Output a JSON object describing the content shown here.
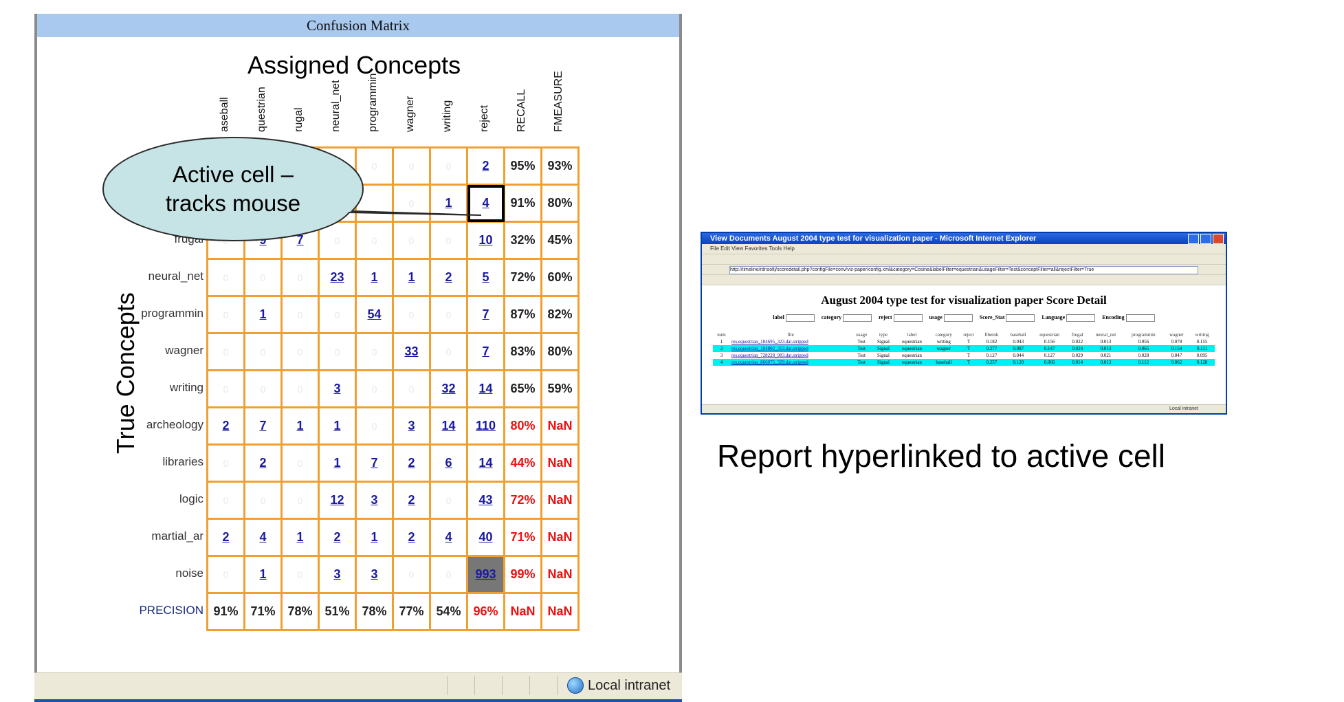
{
  "window": {
    "title": "Confusion Matrix",
    "status_text": "Local intranet"
  },
  "matrix": {
    "heading": "Assigned Concepts",
    "y_label": "True Concepts",
    "columns": [
      "aseball",
      "questrian",
      "rugal",
      "neural_net",
      "programmin",
      "wagner",
      "writing",
      "reject",
      "RECALL",
      "FMEASURE"
    ],
    "rows": [
      {
        "label": "",
        "cells": [
          "",
          "",
          "",
          "",
          "0",
          "0",
          "0",
          "2",
          "95%",
          "93%"
        ]
      },
      {
        "label": "",
        "cells": [
          "",
          "",
          "",
          "",
          "",
          "0",
          "1",
          "4",
          "91%",
          "80%"
        ]
      },
      {
        "label": "frugal",
        "cells": [
          "0",
          "9",
          "7",
          "0",
          "0",
          "0",
          "0",
          "10",
          "32%",
          "45%"
        ]
      },
      {
        "label": "neural_net",
        "cells": [
          "0",
          "0",
          "0",
          "23",
          "1",
          "1",
          "2",
          "5",
          "72%",
          "60%"
        ]
      },
      {
        "label": "programmin",
        "cells": [
          "0",
          "1",
          "0",
          "0",
          "54",
          "0",
          "0",
          "7",
          "87%",
          "82%"
        ]
      },
      {
        "label": "wagner",
        "cells": [
          "0",
          "0",
          "0",
          "0",
          "0",
          "33",
          "0",
          "7",
          "83%",
          "80%"
        ]
      },
      {
        "label": "writing",
        "cells": [
          "0",
          "0",
          "0",
          "3",
          "0",
          "0",
          "32",
          "14",
          "65%",
          "59%"
        ]
      },
      {
        "label": "archeology",
        "cells": [
          "2",
          "7",
          "1",
          "1",
          "0",
          "3",
          "14",
          "110",
          "80%",
          "NaN"
        ]
      },
      {
        "label": "libraries",
        "cells": [
          "0",
          "2",
          "0",
          "1",
          "7",
          "2",
          "6",
          "14",
          "44%",
          "NaN"
        ]
      },
      {
        "label": "logic",
        "cells": [
          "0",
          "0",
          "0",
          "12",
          "3",
          "2",
          "0",
          "43",
          "72%",
          "NaN"
        ]
      },
      {
        "label": "martial_ar",
        "cells": [
          "2",
          "4",
          "1",
          "2",
          "1",
          "2",
          "4",
          "40",
          "71%",
          "NaN"
        ]
      },
      {
        "label": "noise",
        "cells": [
          "0",
          "1",
          "0",
          "3",
          "3",
          "0",
          "0",
          "993",
          "99%",
          "NaN"
        ]
      },
      {
        "label": "PRECISION",
        "cells": [
          "91%",
          "71%",
          "78%",
          "51%",
          "78%",
          "77%",
          "54%",
          "96%",
          "NaN",
          "NaN"
        ]
      }
    ],
    "red_cells": [
      [
        7,
        8
      ],
      [
        8,
        8
      ],
      [
        9,
        8
      ],
      [
        10,
        8
      ],
      [
        11,
        8
      ],
      [
        12,
        7
      ],
      [
        12,
        8
      ],
      [
        7,
        9
      ],
      [
        8,
        9
      ],
      [
        9,
        9
      ],
      [
        10,
        9
      ],
      [
        11,
        9
      ],
      [
        12,
        9
      ]
    ],
    "active_cell": [
      1,
      7
    ],
    "highlight_cell": [
      11,
      7
    ],
    "colors": {
      "grid": "#f0a030",
      "link": "#1a1aa0",
      "red": "#ee1010",
      "title_bar": "#a9c9ef"
    }
  },
  "callout": {
    "line1": "Active cell –",
    "line2": "tracks mouse",
    "fill": "#c6e4e6"
  },
  "report": {
    "window_title": "View Documents August 2004 type test for visualization paper - Microsoft Internet Explorer",
    "heading": "August 2004 type test for visualization paper Score Detail",
    "menu": "File  Edit  View  Favorites  Tools  Help",
    "address": "http://timeline/rdnsoltj/scoredetail.php?configFile=conv/viz-paper/config.xml&category=Cosine&labelFilter=equestrian&usageFilter=Test&conceptFilter=all&rejectFilter=True",
    "filters": [
      "label",
      "category",
      "reject",
      "usage",
      "Score_Stat",
      "Language",
      "Encoding"
    ],
    "columns": [
      "num",
      "file",
      "usage",
      "type",
      "label",
      "category",
      "reject",
      "fiberok",
      "baseball",
      "equestrian",
      "frugal",
      "neural_net",
      "programmin",
      "wagner",
      "writing"
    ],
    "rows": [
      [
        "1",
        "res.equestrian_184695_323.dat.stripped",
        "Test",
        "Signal",
        "equestrian",
        "writing",
        "T",
        "0.182",
        "0.043",
        "0.156",
        "0.022",
        "0.013",
        "0.056",
        "0.078",
        "0.155"
      ],
      [
        "2",
        "res.equestrian_184802_313.dat.stripped",
        "Test",
        "Signal",
        "equestrian",
        "wagner",
        "T",
        "0.277",
        "0.087",
        "0.147",
        "0.024",
        "0.013",
        "0.065",
        "0.154",
        "0.111"
      ],
      [
        "3",
        "res.equestrian_728228_983.dat.stripped",
        "Test",
        "Signal",
        "equestrian",
        "",
        "T",
        "0.127",
        "0.044",
        "0.127",
        "0.029",
        "0.021",
        "0.028",
        "0.047",
        "0.095"
      ],
      [
        "4",
        "res.equestrian_866075_329.dat.stripped",
        "Test",
        "Signal",
        "equestrian",
        "baseball",
        "T",
        "0.257",
        "0.120",
        "0.066",
        "0.014",
        "0.013",
        "0.112",
        "0.062",
        "0.128"
      ]
    ],
    "cyan_rows": [
      1,
      3
    ],
    "status": "Local intranet",
    "caption": "Report hyperlinked to active cell"
  }
}
